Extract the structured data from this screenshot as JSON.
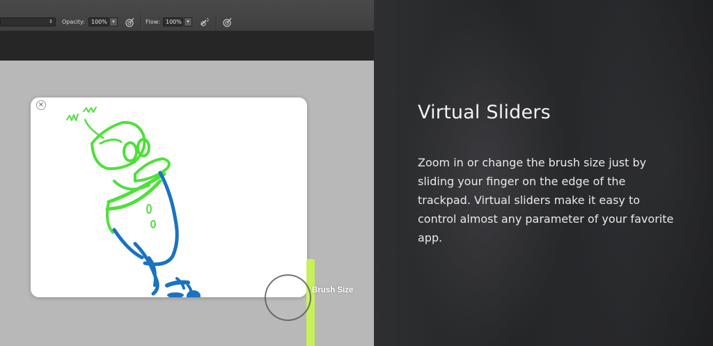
{
  "options_bar": {
    "opacity_label": "Opacity:",
    "opacity_value": "100%",
    "flow_label": "Flow:",
    "flow_value": "100%",
    "icons": [
      "pressure-opacity-icon",
      "airbrush-icon",
      "pressure-size-icon"
    ]
  },
  "popup": {
    "close_symbol": "×"
  },
  "virtual_slider": {
    "label": "Brush Size",
    "accent_color": "#c8f05a"
  },
  "info": {
    "title": "Virtual Sliders",
    "body": "Zoom in or change the brush size just by sliding your finger on the edge of the trackpad. Virtual sliders make it easy to control almost any parameter of your favorite app."
  },
  "colors": {
    "sketch_green": "#4ee03a",
    "sketch_blue": "#1a72c2"
  }
}
